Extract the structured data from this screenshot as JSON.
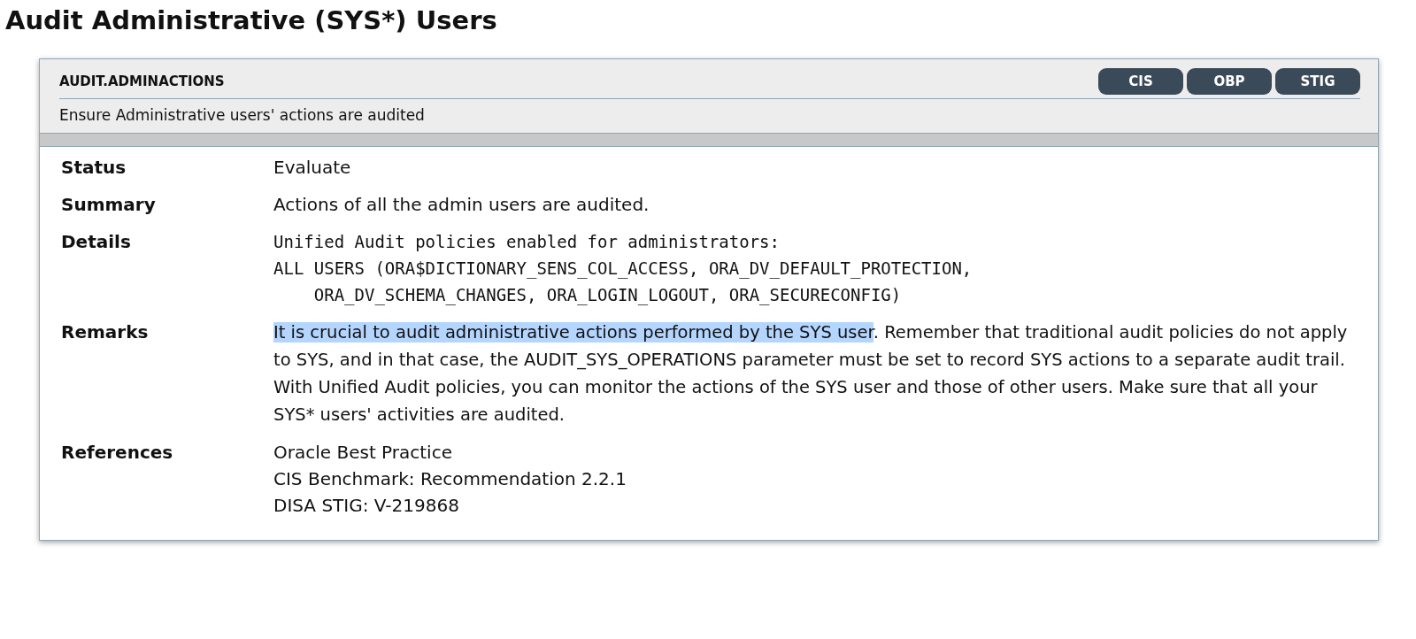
{
  "page_title": "Audit Administrative (SYS*) Users",
  "check": {
    "id": "AUDIT.ADMINACTIONS",
    "tags": [
      "CIS",
      "OBP",
      "STIG"
    ],
    "description": "Ensure Administrative users' actions are audited",
    "rows": [
      {
        "kind": "text",
        "label": "Status",
        "lines": [
          "Evaluate"
        ]
      },
      {
        "kind": "text",
        "label": "Summary",
        "lines": [
          "Actions of all the admin users are audited."
        ]
      },
      {
        "kind": "code",
        "label": "Details",
        "lines": [
          "Unified Audit policies enabled for administrators:",
          "ALL USERS (ORA$DICTIONARY_SENS_COL_ACCESS, ORA_DV_DEFAULT_PROTECTION,",
          "    ORA_DV_SCHEMA_CHANGES, ORA_LOGIN_LOGOUT, ORA_SECURECONFIG)"
        ]
      },
      {
        "kind": "paragraph",
        "label": "Remarks",
        "selected_text": "It is crucial to audit administrative actions performed by the SYS user",
        "text": ". Remember that traditional audit policies do not apply to SYS, and in that case, the AUDIT_SYS_OPERATIONS parameter must be set to record SYS actions to a separate audit trail. With Unified Audit policies, you can monitor the actions of the SYS user and those of other users. Make sure that all your SYS* users' activities are audited."
      },
      {
        "kind": "text",
        "label": "References",
        "lines": [
          "Oracle Best Practice",
          "CIS Benchmark: Recommendation 2.2.1",
          "DISA STIG: V-219868"
        ]
      }
    ]
  }
}
